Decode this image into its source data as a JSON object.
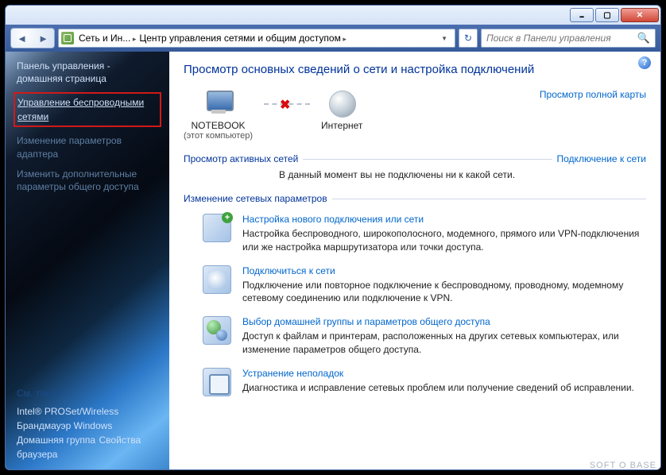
{
  "titlebar": {},
  "nav": {
    "crumb1": "Сеть и Ин...",
    "crumb2": "Центр управления сетями и общим доступом",
    "search_placeholder": "Поиск в Панели управления"
  },
  "sidebar": {
    "home": "Панель управления - домашняя страница",
    "wireless": "Управление беспроводными сетями",
    "adapter": "Изменение параметров адаптера",
    "sharing": "Изменить дополнительные параметры общего доступа",
    "see_also": "См. также",
    "intel": "Intel® PROSet/Wireless",
    "firewall": "Брандмауэр Windows",
    "homegroup": "Домашняя группа",
    "browser": "Свойства браузера"
  },
  "main": {
    "title": "Просмотр основных сведений о сети и настройка подключений",
    "computer": "NOTEBOOK",
    "computer_sub": "(этот компьютер)",
    "internet": "Интернет",
    "full_map": "Просмотр полной карты",
    "active_hdr": "Просмотр активных сетей",
    "connect_link": "Подключение к сети",
    "no_conn": "В данный момент вы не подключены ни к какой сети.",
    "change_hdr": "Изменение сетевых параметров",
    "items": [
      {
        "title": "Настройка нового подключения или сети",
        "desc": "Настройка беспроводного, широкополосного, модемного, прямого или VPN-подключения или же настройка маршрутизатора или точки доступа."
      },
      {
        "title": "Подключиться к сети",
        "desc": "Подключение или повторное подключение к беспроводному, проводному, модемному сетевому соединению или подключение к VPN."
      },
      {
        "title": "Выбор домашней группы и параметров общего доступа",
        "desc": "Доступ к файлам и принтерам, расположенных на других сетевых компьютерах, или изменение параметров общего доступа."
      },
      {
        "title": "Устранение неполадок",
        "desc": "Диагностика и исправление сетевых проблем или получение сведений об исправлении."
      }
    ]
  },
  "watermark": "SOFT O BASE"
}
